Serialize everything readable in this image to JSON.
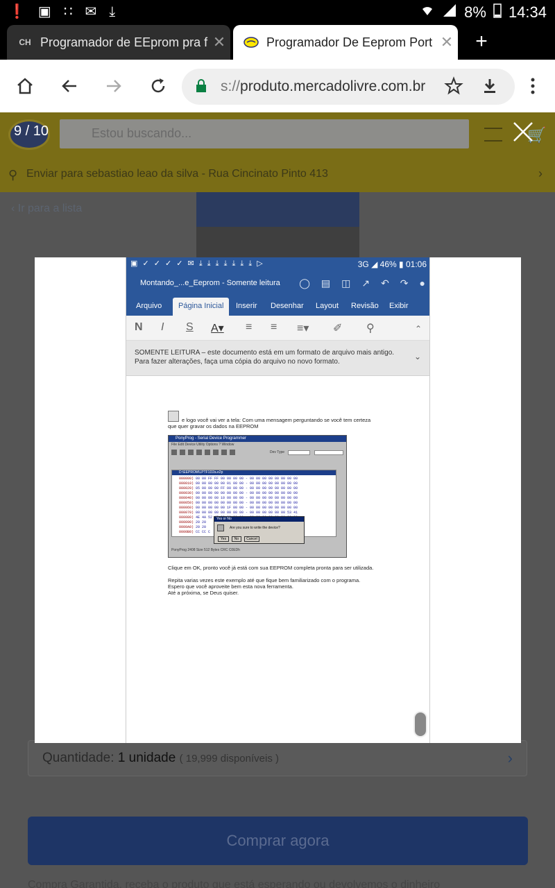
{
  "status_bar": {
    "battery": "8%",
    "time": "14:34"
  },
  "tabs": [
    {
      "label": "Programador de EEprom pra f"
    },
    {
      "label": "Programador De Eeprom Port"
    }
  ],
  "omnibox": {
    "url_prefix": "s://",
    "url_host": "produto.mercadolivre.com.br"
  },
  "background_page": {
    "search_placeholder": "Estou buscando...",
    "shipping": "Enviar para sebastiao leao da silva - Rua Cincinato Pinto 413",
    "back_link": "Ir para a lista",
    "quantity_label": "Quantidade:",
    "quantity_value": "1 unidade",
    "quantity_available": "( 19,999 disponíveis )",
    "buy_button": "Comprar agora",
    "footer_text": "Compra Garantida, receba o produto que está esperando ou devolvemos o dinheiro"
  },
  "lightbox": {
    "counter": "9 / 10"
  },
  "phone_image": {
    "status_time": "01:06",
    "status_battery": "46%",
    "status_network": "3G",
    "doc_title": "Montando_...e_Eeprom - Somente leitura",
    "ribbon_tabs": [
      "Arquivo",
      "Página Inicial",
      "Inserir",
      "Desenhar",
      "Layout",
      "Revisão",
      "Exibir"
    ],
    "warning_line1": "SOMENTE LEITURA – este documento está em um formato de arquivo mais antigo.",
    "warning_line2": "Para fazer alterações, faça uma cópia do arquivo no novo formato.",
    "doc_text": {
      "line1": "e logo você vai ver a tela: Com uma mensagem perguntando se você tem certeza",
      "line2": "que quer gravar os dados na EEPROM",
      "line3": "Clique em OK, pronto você já está com sua EEPROM completa pronta para ser utilizada.",
      "line4": "Repita varias vezes este exemplo até que fique bem familiarizado com o programa.",
      "line5": "Espero que você aproveite bem esta nova ferramenta.",
      "line6": "Até a próxima, se Deus quiser."
    },
    "ponyprog": {
      "title": "PonyProg - Serial Device Programmer",
      "menu": "File  Edit  Device  Utility  Options  ?  Window",
      "device_label": "Dev Type",
      "inner_title": "D:\\EEPROM\\LPTF1D2a.e2p",
      "dialog_title": "Yes or No",
      "dialog_msg": "Are you sure to write the device?",
      "btn_yes": "Yes",
      "btn_no": "No",
      "btn_cancel": "Cancel",
      "status": "PonyProg      2408       Size  512 Bytes    CRC  C0EDh"
    }
  }
}
